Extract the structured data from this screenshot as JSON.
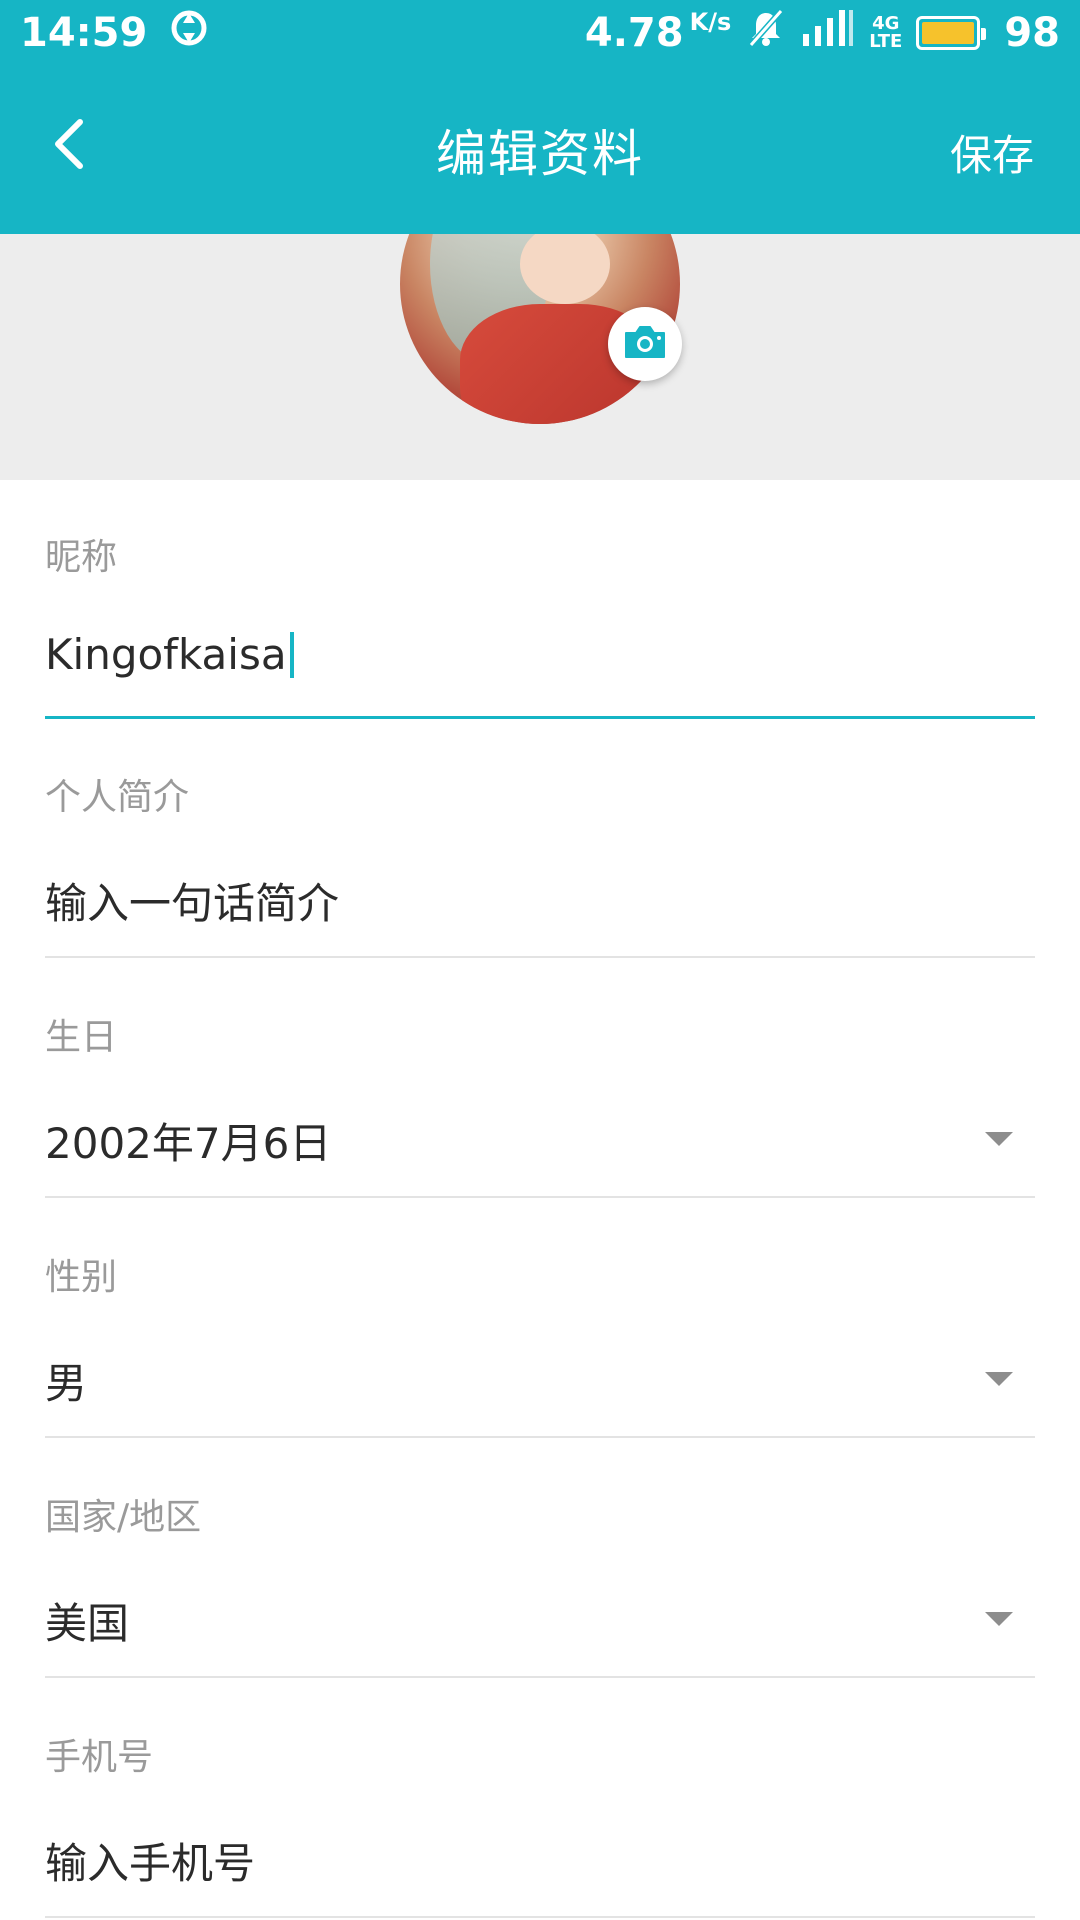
{
  "status_bar": {
    "time": "14:59",
    "speed_value": "4.78",
    "speed_unit": "K/s",
    "network_top": "4G",
    "network_bottom": "LTE",
    "battery": "98"
  },
  "app_bar": {
    "title": "编辑资料",
    "save_label": "保存"
  },
  "form": {
    "nickname": {
      "label": "昵称",
      "value": "Kingofkaisa"
    },
    "bio": {
      "label": "个人简介",
      "placeholder": "输入一句话简介"
    },
    "birthday": {
      "label": "生日",
      "value": "2002年7月6日"
    },
    "gender": {
      "label": "性别",
      "value": "男"
    },
    "region": {
      "label": "国家/地区",
      "value": "美国"
    },
    "phone": {
      "label": "手机号",
      "placeholder": "输入手机号"
    }
  },
  "colors": {
    "accent": "#16b5c5",
    "battery": "#f6c22c"
  },
  "icons": [
    "back-arrow-icon",
    "camera-icon",
    "dropdown-arrow-icon",
    "signal-icon",
    "mute-icon",
    "battery-icon",
    "sync-icon"
  ]
}
